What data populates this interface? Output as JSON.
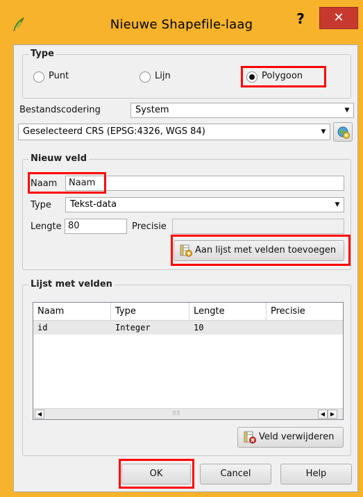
{
  "window": {
    "title": "Nieuwe Shapefile-laag",
    "help_glyph": "?",
    "close_glyph": "✕"
  },
  "type_group": {
    "title": "Type",
    "options": [
      {
        "label": "Punt",
        "checked": false
      },
      {
        "label": "Lijn",
        "checked": false
      },
      {
        "label": "Polygoon",
        "checked": true
      }
    ]
  },
  "encoding": {
    "label": "Bestandscodering",
    "value": "System"
  },
  "crs": {
    "value": "Geselecteerd CRS (EPSG:4326, WGS 84)"
  },
  "new_field": {
    "title": "Nieuw veld",
    "name_label": "Naam",
    "name_value": "Naam",
    "type_label": "Type",
    "type_value": "Tekst-data",
    "length_label": "Lengte",
    "length_value": "80",
    "precision_label": "Precisie",
    "precision_value": "",
    "add_button": "Aan lijst met velden toevoegen"
  },
  "field_list": {
    "title": "Lijst met velden",
    "columns": [
      "Naam",
      "Type",
      "Lengte",
      "Precisie"
    ],
    "rows": [
      [
        "id",
        "Integer",
        "10",
        ""
      ]
    ],
    "remove_button": "Veld verwijderen"
  },
  "footer": {
    "ok": "OK",
    "cancel": "Cancel",
    "help": "Help"
  },
  "colors": {
    "window_frame": "#f7b32b",
    "close_button": "#c7392f",
    "highlight": "#ff0000"
  }
}
